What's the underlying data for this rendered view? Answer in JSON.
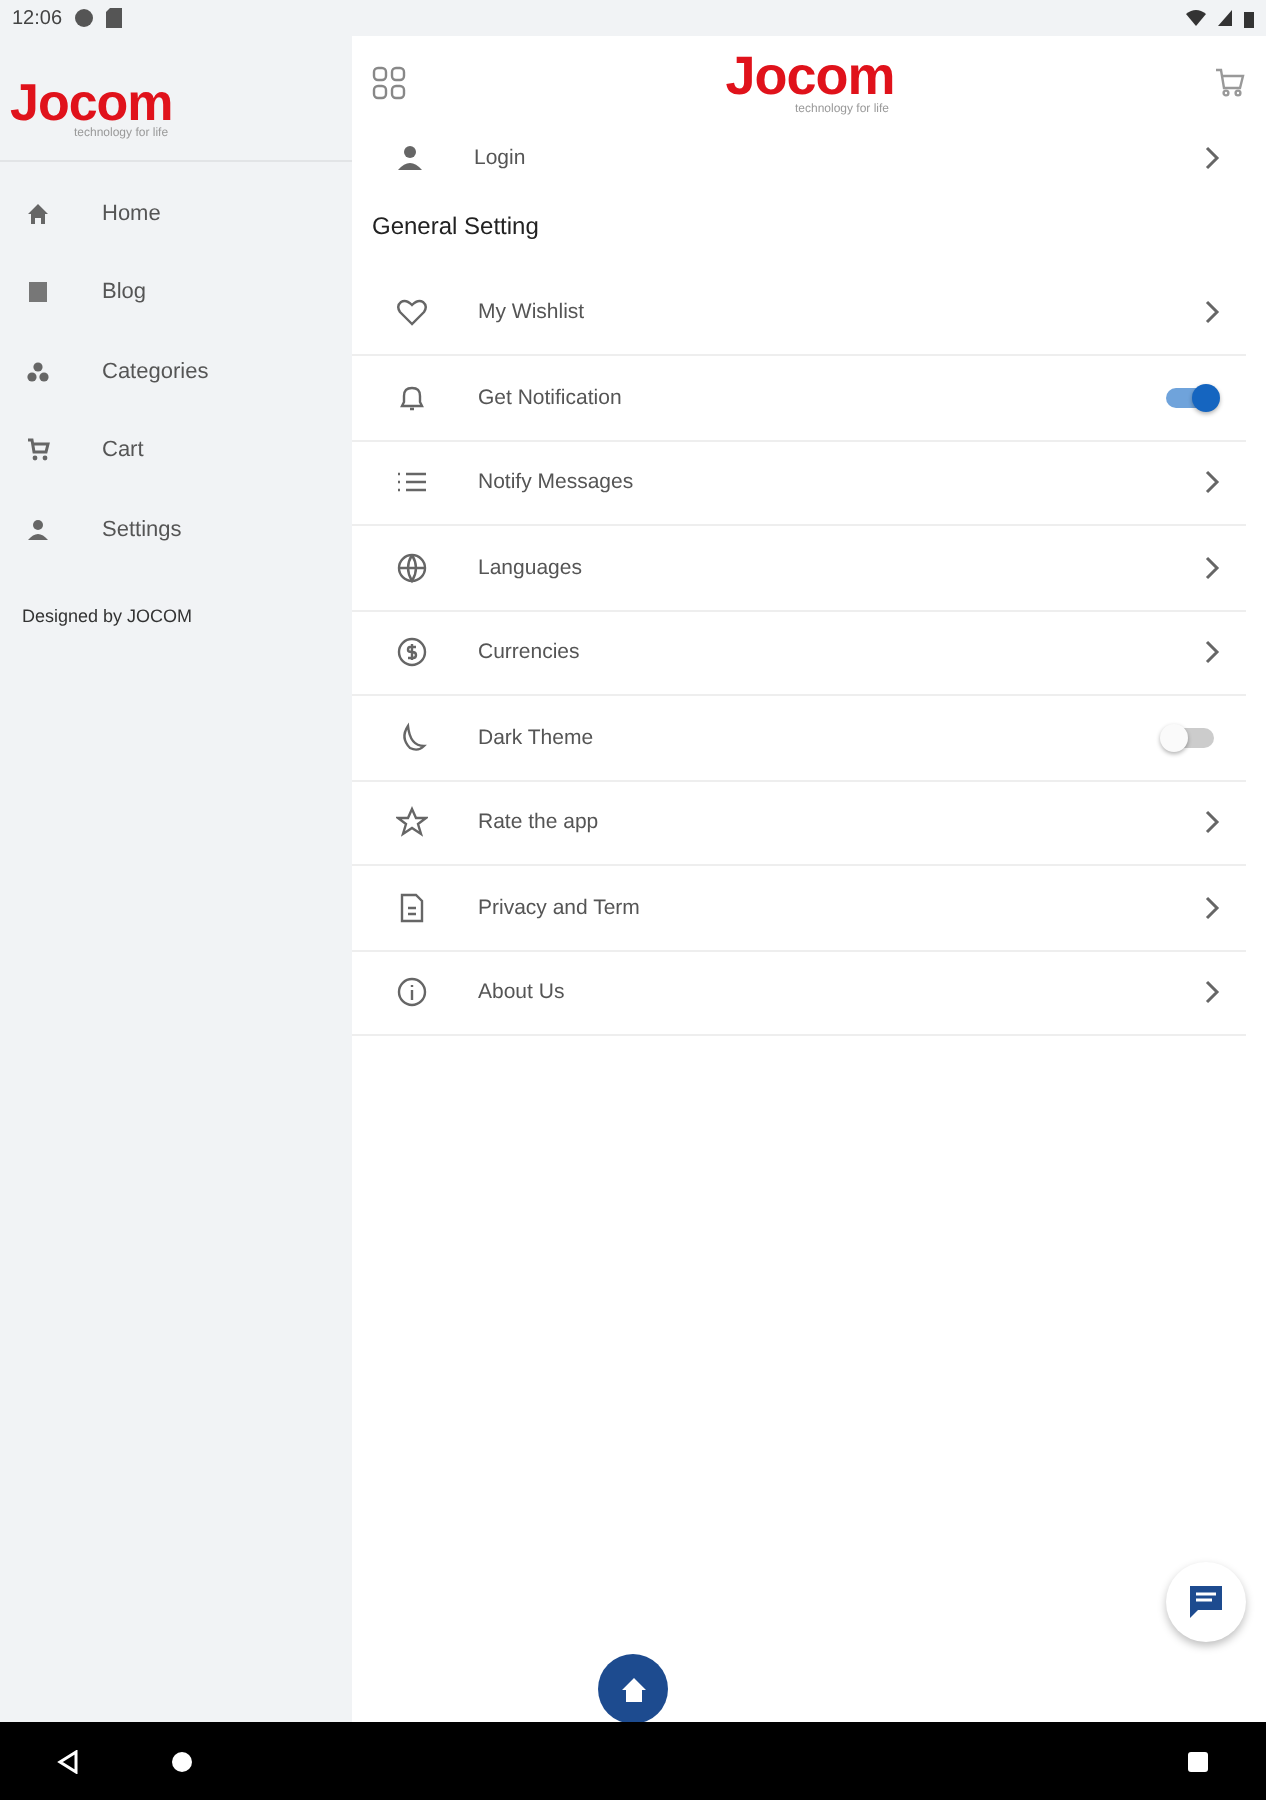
{
  "status_bar": {
    "time": "12:06"
  },
  "logo": {
    "name": "Jocom",
    "tagline": "technology for life"
  },
  "sidebar": {
    "items": [
      {
        "label": "Home"
      },
      {
        "label": "Blog"
      },
      {
        "label": "Categories"
      },
      {
        "label": "Cart"
      },
      {
        "label": "Settings"
      }
    ],
    "footer": "Designed by JOCOM"
  },
  "header": {
    "logo": {
      "name": "Jocom",
      "tagline": "technology for life"
    }
  },
  "login": {
    "label": "Login"
  },
  "section_title": "General Setting",
  "settings": [
    {
      "label": "My Wishlist",
      "kind": "link"
    },
    {
      "label": "Get Notification",
      "kind": "toggle",
      "on": true
    },
    {
      "label": "Notify Messages",
      "kind": "link"
    },
    {
      "label": "Languages",
      "kind": "link"
    },
    {
      "label": "Currencies",
      "kind": "link"
    },
    {
      "label": "Dark Theme",
      "kind": "toggle",
      "on": false
    },
    {
      "label": "Rate the app",
      "kind": "link"
    },
    {
      "label": "Privacy and Term",
      "kind": "link"
    },
    {
      "label": "About Us",
      "kind": "link"
    }
  ]
}
